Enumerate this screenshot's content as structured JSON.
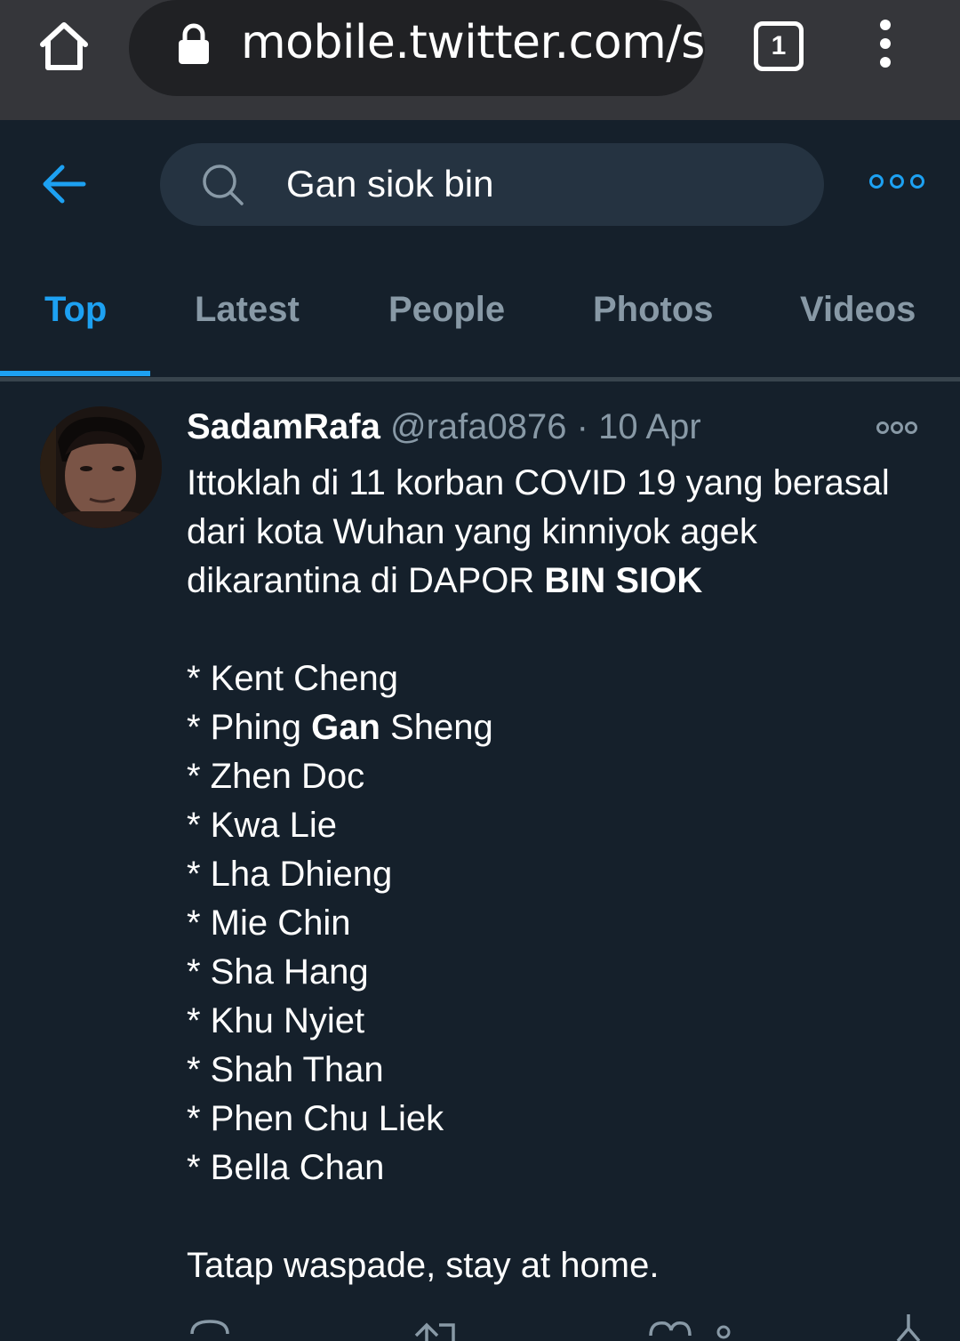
{
  "browser": {
    "url": "mobile.twitter.com/s",
    "tab_count": "1",
    "icons": [
      "home-icon",
      "lock-icon",
      "tab-switcher-icon",
      "menu-icon"
    ]
  },
  "header": {
    "search_query": "Gan siok bin",
    "accent_color": "#1da1f2",
    "background_color": "#15202b"
  },
  "tabs": [
    {
      "label": "Top",
      "active": true
    },
    {
      "label": "Latest",
      "active": false
    },
    {
      "label": "People",
      "active": false
    },
    {
      "label": "Photos",
      "active": false
    },
    {
      "label": "Videos",
      "active": false
    }
  ],
  "tweet": {
    "display_name": "SadamRafa",
    "handle": "@rafa0876",
    "separator": "·",
    "date": "10 Apr",
    "intro": {
      "line1": "Ittoklah di 11 korban COVID 19 yang berasal",
      "line2": "dari kota Wuhan  yang kinniyok agek",
      "line3_prefix": "dikarantina di DAPOR ",
      "line3_bold": "BIN SIOK"
    },
    "list": [
      {
        "prefix": "* Kent Cheng",
        "bold": "",
        "suffix": ""
      },
      {
        "prefix": "* Phing ",
        "bold": "Gan",
        "suffix": " Sheng"
      },
      {
        "prefix": "* Zhen Doc",
        "bold": "",
        "suffix": ""
      },
      {
        "prefix": "* Kwa Lie",
        "bold": "",
        "suffix": ""
      },
      {
        "prefix": "* Lha Dhieng",
        "bold": "",
        "suffix": ""
      },
      {
        "prefix": "* Mie Chin",
        "bold": "",
        "suffix": ""
      },
      {
        "prefix": "* Sha Hang",
        "bold": "",
        "suffix": ""
      },
      {
        "prefix": "* Khu Nyiet",
        "bold": "",
        "suffix": ""
      },
      {
        "prefix": "* Shah Than",
        "bold": "",
        "suffix": ""
      },
      {
        "prefix": "* Phen Chu Liek",
        "bold": "",
        "suffix": ""
      },
      {
        "prefix": "* Bella Chan",
        "bold": "",
        "suffix": ""
      }
    ],
    "closing": "Tatap waspade, stay at home."
  }
}
